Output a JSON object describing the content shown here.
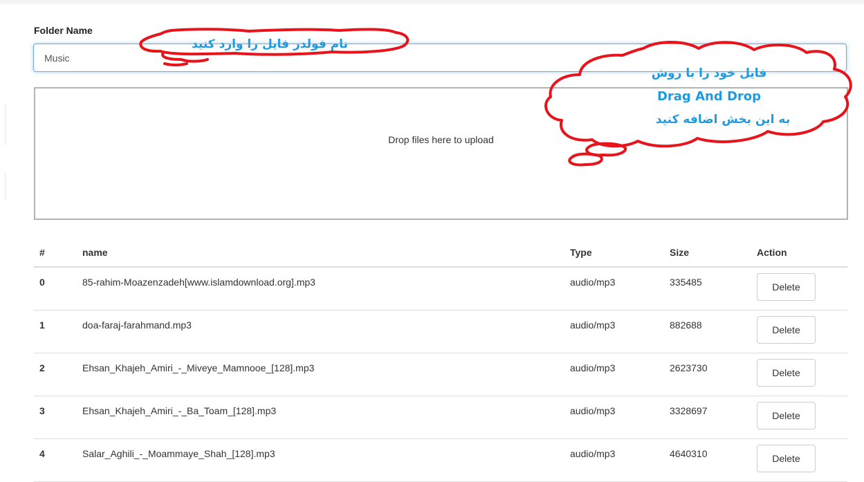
{
  "folder": {
    "label": "Folder Name",
    "value": "Music"
  },
  "dropzone": {
    "text": "Drop files here to upload"
  },
  "table": {
    "headers": [
      "#",
      "name",
      "Type",
      "Size",
      "Action"
    ],
    "rows": [
      {
        "index": "0",
        "name": "85-rahim-Moazenzadeh[www.islamdownload.org].mp3",
        "type": "audio/mp3",
        "size": "335485",
        "action": "Delete"
      },
      {
        "index": "1",
        "name": "doa-faraj-farahmand.mp3",
        "type": "audio/mp3",
        "size": "882688",
        "action": "Delete"
      },
      {
        "index": "2",
        "name": "Ehsan_Khajeh_Amiri_-_Miveye_Mamnooe_[128].mp3",
        "type": "audio/mp3",
        "size": "2623730",
        "action": "Delete"
      },
      {
        "index": "3",
        "name": "Ehsan_Khajeh_Amiri_-_Ba_Toam_[128].mp3",
        "type": "audio/mp3",
        "size": "3328697",
        "action": "Delete"
      },
      {
        "index": "4",
        "name": "Salar_Aghili_-_Moammaye_Shah_[128].mp3",
        "type": "audio/mp3",
        "size": "4640310",
        "action": "Delete"
      }
    ]
  },
  "annotations": {
    "folder_note": "نام فولدر فایل را وارد کنید",
    "drop_note_line1": "فایل خود را با روش",
    "drop_note_line2": "Drag And Drop",
    "drop_note_line3": "به این بخش اضافه کنید"
  },
  "colors": {
    "annotation_stroke": "#e8141c",
    "annotation_text": "#1e9be0",
    "input_focus": "#66afe9"
  }
}
